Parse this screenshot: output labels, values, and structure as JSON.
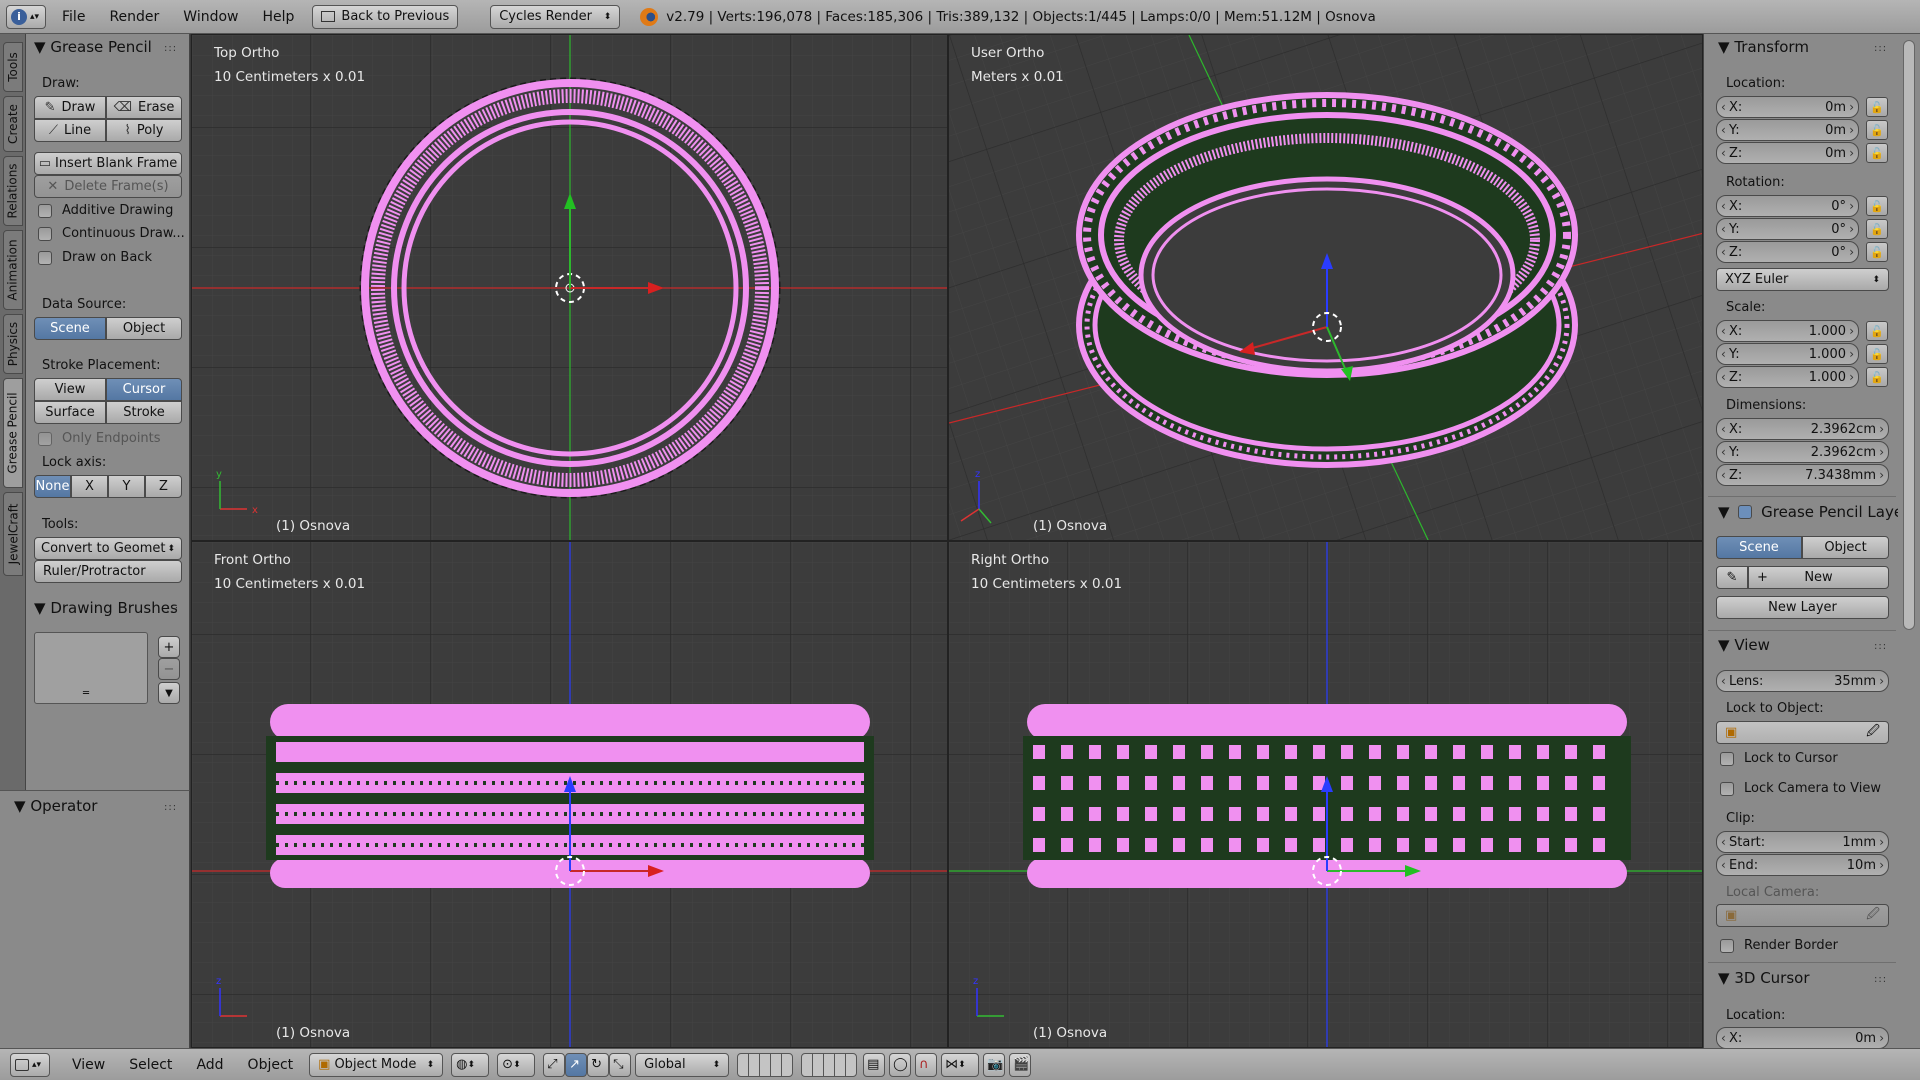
{
  "topbar": {
    "menus": [
      "File",
      "Render",
      "Window",
      "Help"
    ],
    "back_button": "Back to Previous",
    "render_engine": "Cycles Render",
    "stats": "v2.79 | Verts:196,078 | Faces:185,306 | Tris:389,132 | Objects:1/445 | Lamps:0/0 | Mem:51.12M | Osnova"
  },
  "tabs": [
    "Tools",
    "Create",
    "Relations",
    "Animation",
    "Physics",
    "Grease Pencil",
    "JewelCraft"
  ],
  "toolshelf": {
    "header": "Grease Pencil",
    "draw_label": "Draw:",
    "draw": "Draw",
    "erase": "Erase",
    "line": "Line",
    "poly": "Poly",
    "insert_blank_frame": "Insert Blank Frame",
    "delete_frames": "Delete Frame(s)",
    "additive_drawing": "Additive Drawing",
    "continuous_draw": "Continuous Draw...",
    "draw_on_back": "Draw on Back",
    "data_source_label": "Data Source:",
    "scene": "Scene",
    "object": "Object",
    "stroke_placement_label": "Stroke Placement:",
    "view": "View",
    "cursor": "Cursor",
    "surface": "Surface",
    "stroke": "Stroke",
    "only_endpoints": "Only Endpoints",
    "lock_axis_label": "Lock axis:",
    "lock_none": "None",
    "lock_x": "X",
    "lock_y": "Y",
    "lock_z": "Z",
    "tools_label": "Tools:",
    "convert_to_geometry": "Convert to Geomet",
    "ruler": "Ruler/Protractor",
    "drawing_brushes": "Drawing Brushes"
  },
  "operator_panel": {
    "header": "Operator"
  },
  "viewports": {
    "top": {
      "name": "Top Ortho",
      "scale": "10 Centimeters x 0.01",
      "object": "(1) Osnova"
    },
    "user": {
      "name": "User Ortho",
      "scale": "Meters x 0.01",
      "object": "(1) Osnova"
    },
    "front": {
      "name": "Front Ortho",
      "scale": "10 Centimeters x 0.01",
      "object": "(1) Osnova"
    },
    "right": {
      "name": "Right Ortho",
      "scale": "10 Centimeters x 0.01",
      "object": "(1) Osnova"
    }
  },
  "props": {
    "transform": "Transform",
    "location_label": "Location:",
    "loc_x": "X:",
    "loc_x_val": "0m",
    "loc_y": "Y:",
    "loc_y_val": "0m",
    "loc_z": "Z:",
    "loc_z_val": "0m",
    "rotation_label": "Rotation:",
    "rot_x": "X:",
    "rot_x_val": "0°",
    "rot_y": "Y:",
    "rot_y_val": "0°",
    "rot_z": "Z:",
    "rot_z_val": "0°",
    "rotation_mode": "XYZ Euler",
    "scale_label": "Scale:",
    "sc_x": "X:",
    "sc_x_val": "1.000",
    "sc_y": "Y:",
    "sc_y_val": "1.000",
    "sc_z": "Z:",
    "sc_z_val": "1.000",
    "dimensions_label": "Dimensions:",
    "dim_x": "X:",
    "dim_x_val": "2.3962cm",
    "dim_y": "Y:",
    "dim_y_val": "2.3962cm",
    "dim_z": "Z:",
    "dim_z_val": "7.3438mm",
    "gp_layers": "Grease Pencil Layers",
    "scene": "Scene",
    "object": "Object",
    "new": "New",
    "new_layer": "New Layer",
    "view": "View",
    "lens": "Lens:",
    "lens_val": "35mm",
    "lock_to_object": "Lock to Object:",
    "lock_to_cursor": "Lock to Cursor",
    "lock_camera": "Lock Camera to View",
    "clip_label": "Clip:",
    "clip_start": "Start:",
    "clip_start_val": "1mm",
    "clip_end": "End:",
    "clip_end_val": "10m",
    "local_camera": "Local Camera:",
    "render_border": "Render Border",
    "cursor3d": "3D Cursor",
    "cursor_location": "Location:",
    "cursor_x": "X:",
    "cursor_x_val": "0m"
  },
  "bottombar": {
    "menus": [
      "View",
      "Select",
      "Add",
      "Object"
    ],
    "mode": "Object Mode",
    "orientation": "Global"
  },
  "colors": {
    "mesh": "#f090f0",
    "dark": "#1e3a1e",
    "xaxis": "#c82828",
    "yaxis": "#2db82d",
    "zaxis": "#2a3cff"
  }
}
